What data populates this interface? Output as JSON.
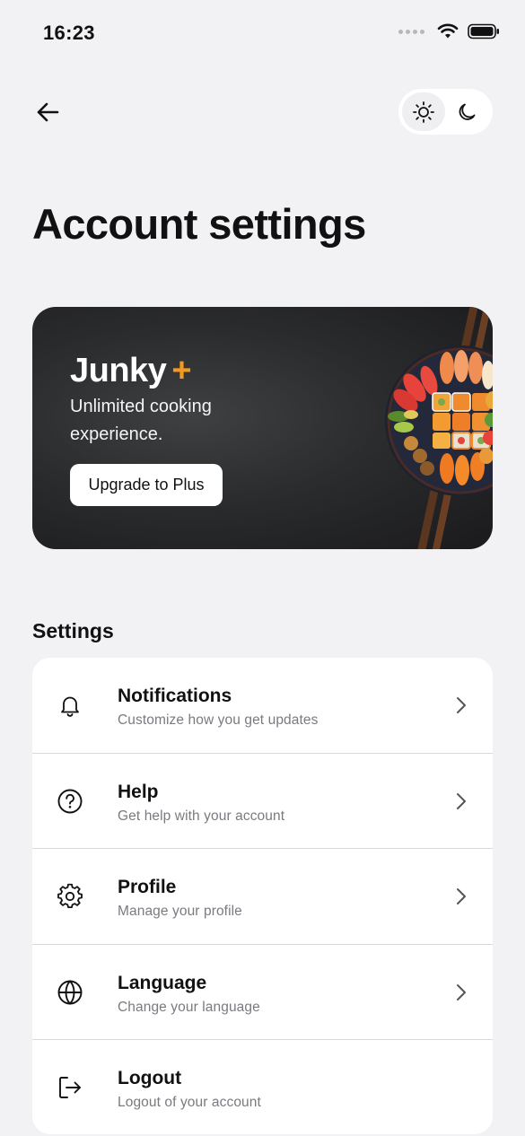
{
  "status_bar": {
    "time": "16:23",
    "icons": [
      "signal-dots-icon",
      "wifi-icon",
      "battery-icon"
    ]
  },
  "header": {
    "back_icon": "arrow-left-icon",
    "theme_toggle": {
      "options": [
        {
          "name": "light",
          "icon": "sun-icon",
          "active": true
        },
        {
          "name": "dark",
          "icon": "moon-icon",
          "active": false
        }
      ]
    }
  },
  "page": {
    "title": "Account settings"
  },
  "promo": {
    "brand": "Junky",
    "brand_plus": "+",
    "text": "Unlimited cooking experience.",
    "button_label": "Upgrade to Plus",
    "accent_color": "#f29a1f",
    "image": "sushi-platter-illustration"
  },
  "settings": {
    "title": "Settings",
    "items": [
      {
        "icon": "bell-icon",
        "title": "Notifications",
        "subtitle": "Customize how you get updates",
        "chevron": true
      },
      {
        "icon": "help-circle-icon",
        "title": "Help",
        "subtitle": "Get help with your account",
        "chevron": true
      },
      {
        "icon": "gear-icon",
        "title": "Profile",
        "subtitle": "Manage your profile",
        "chevron": true
      },
      {
        "icon": "globe-icon",
        "title": "Language",
        "subtitle": "Change your language",
        "chevron": true
      },
      {
        "icon": "logout-icon",
        "title": "Logout",
        "subtitle": "Logout of your account",
        "chevron": false
      }
    ]
  }
}
